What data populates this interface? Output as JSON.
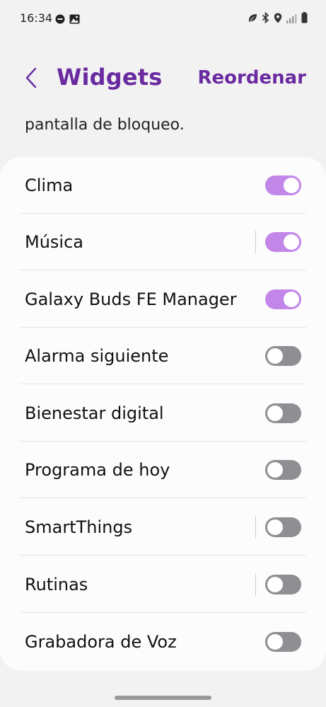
{
  "status_bar": {
    "time": "16:34",
    "left_icons": [
      "dnd-icon",
      "gallery-icon"
    ],
    "right_icons": [
      "leaf-icon",
      "bluetooth-icon",
      "location-icon",
      "signal-icon",
      "battery-icon"
    ]
  },
  "header": {
    "back_icon": "chevron-left-icon",
    "title": "Widgets",
    "action_label": "Reordenar"
  },
  "subtitle": "pantalla de bloqueo.",
  "colors": {
    "accent": "#6a2aa0",
    "toggle_on": "#c285e8",
    "toggle_off": "#8e8e93"
  },
  "widgets": [
    {
      "label": "Clima",
      "enabled": true,
      "has_settings_divider": false
    },
    {
      "label": "Música",
      "enabled": true,
      "has_settings_divider": true
    },
    {
      "label": "Galaxy Buds FE Manager",
      "enabled": true,
      "has_settings_divider": false
    },
    {
      "label": "Alarma siguiente",
      "enabled": false,
      "has_settings_divider": false
    },
    {
      "label": "Bienestar digital",
      "enabled": false,
      "has_settings_divider": false
    },
    {
      "label": "Programa de hoy",
      "enabled": false,
      "has_settings_divider": false
    },
    {
      "label": "SmartThings",
      "enabled": false,
      "has_settings_divider": true
    },
    {
      "label": "Rutinas",
      "enabled": false,
      "has_settings_divider": true
    },
    {
      "label": "Grabadora de Voz",
      "enabled": false,
      "has_settings_divider": false
    }
  ]
}
